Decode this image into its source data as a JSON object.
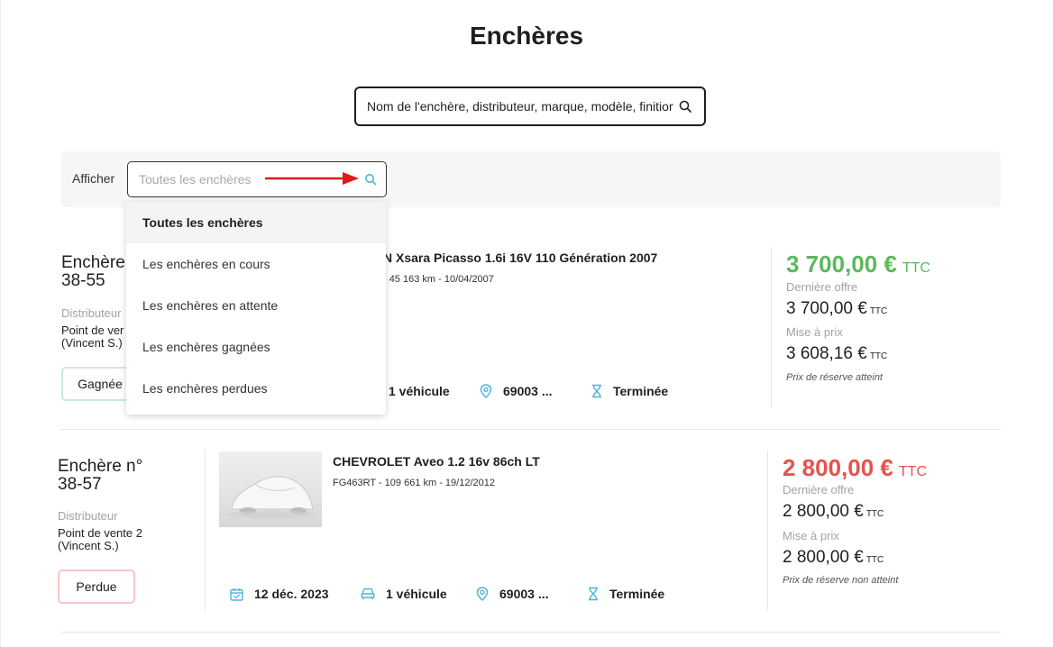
{
  "page": {
    "title": "Enchères"
  },
  "search": {
    "placeholder": "Nom de l'enchère, distributeur, marque, modèle, finition"
  },
  "filter": {
    "label": "Afficher",
    "placeholder": "Toutes les enchères",
    "options": [
      "Toutes les enchères",
      "Les enchères en cours",
      "Les enchères en attente",
      "Les enchères gagnées",
      "Les enchères perdues"
    ],
    "selected_index": 0
  },
  "auctions": [
    {
      "name": "Enchère n° 38-55",
      "visible_name_line1": "Enchère",
      "visible_name_line2": "38-55",
      "distributor_label": "Distributeur",
      "distributor_line1": "Point de vente 2",
      "distributor_line2": "(Vincent S.)",
      "visible_distributor_line1": "Point de ver",
      "visible_distributor_line2": "(Vincent S.)",
      "status": "Gagnée",
      "vehicle_title": "N Xsara Picasso 1.6i 16V 110 Génération 2007",
      "vehicle_sub": "- 45 163 km - 10/04/2007",
      "vehicles": "1 véhicule",
      "location": "69003 ...",
      "state": "Terminée",
      "price": "3 700,00 €",
      "price_unit": "TTC",
      "last_offer_label": "Dernière offre",
      "last_offer": "3 700,00 €",
      "start_price_label": "Mise à prix",
      "start_price": "3 608,16 €",
      "small_unit": "TTC",
      "reserve": "Prix de réserve atteint",
      "accent": "#5cb85c"
    },
    {
      "name_line1": "Enchère n°",
      "name_line2": "38-57",
      "distributor_label": "Distributeur",
      "distributor_line1": "Point de vente 2",
      "distributor_line2": "(Vincent S.)",
      "status": "Perdue",
      "vehicle_title": "CHEVROLET Aveo 1.2 16v 86ch LT",
      "vehicle_sub": "FG463RT - 109 661 km - 19/12/2012",
      "date": "12 déc. 2023",
      "vehicles": "1 véhicule",
      "location": "69003 ...",
      "state": "Terminée",
      "price": "2 800,00 €",
      "price_unit": "TTC",
      "last_offer_label": "Dernière offre",
      "last_offer": "2 800,00 €",
      "start_price_label": "Mise à prix",
      "start_price": "2 800,00 €",
      "small_unit": "TTC",
      "reserve": "Prix de réserve non atteint",
      "accent": "#e5534b"
    }
  ],
  "colors": {
    "icon_blue": "#4fb3d9",
    "arrow_red": "#e3191c",
    "won_border": "#cdebd2",
    "lost_border": "#f5c6c3"
  }
}
